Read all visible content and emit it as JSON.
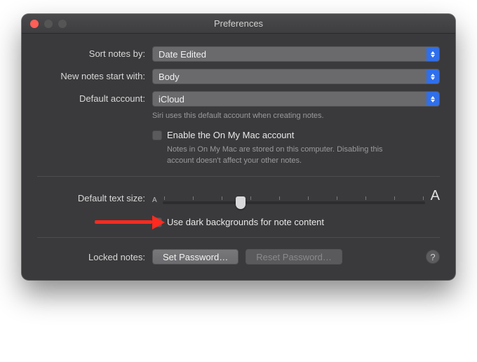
{
  "title": "Preferences",
  "rows": {
    "sort": {
      "label": "Sort notes by:",
      "value": "Date Edited"
    },
    "newNotes": {
      "label": "New notes start with:",
      "value": "Body"
    },
    "defaultAccount": {
      "label": "Default account:",
      "value": "iCloud",
      "hint": "Siri uses this default account when creating notes."
    },
    "enableLocal": {
      "label": "Enable the On My Mac account",
      "hint": "Notes in On My Mac are stored on this computer. Disabling this account doesn't affect your other notes."
    },
    "textSize": {
      "label": "Default text size:",
      "small": "A",
      "large": "A"
    },
    "darkBg": {
      "label": "Use dark backgrounds for note content"
    },
    "locked": {
      "label": "Locked notes:",
      "setPassword": "Set Password…",
      "resetPassword": "Reset Password…"
    }
  },
  "help": "?"
}
